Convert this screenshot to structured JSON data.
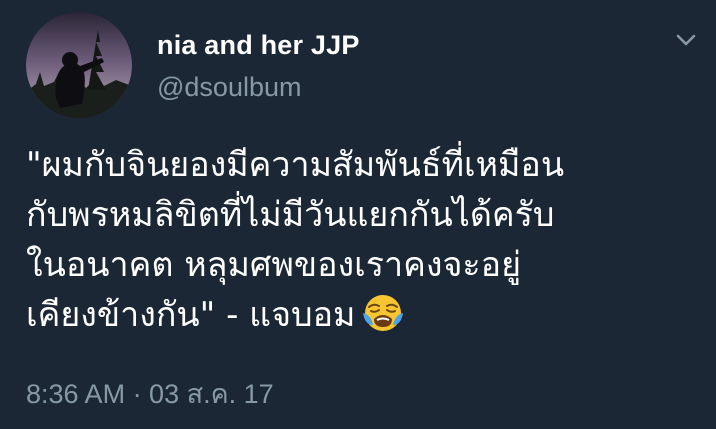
{
  "tweet": {
    "author": {
      "display_name": "nia and her JJP",
      "handle": "@dsoulbum"
    },
    "text_lines": [
      "\"ผมกับจินยองมีความสัมพันธ์ที่เหมือน",
      "กับพรหมลิขิตที่ไม่มีวันแยกกันได้ครับ",
      "ในอนาคต หลุมศพของเราคงจะอยู่",
      "เคียงข้างกัน\" - แจบอม"
    ],
    "emoji": "loudly-crying-face",
    "timestamp": "8:36 AM · 03 ส.ค. 17"
  },
  "colors": {
    "background": "#1b2735",
    "text_primary": "#ffffff",
    "text_secondary": "#8899a6"
  },
  "icons": {
    "menu": "chevron-down-icon"
  }
}
